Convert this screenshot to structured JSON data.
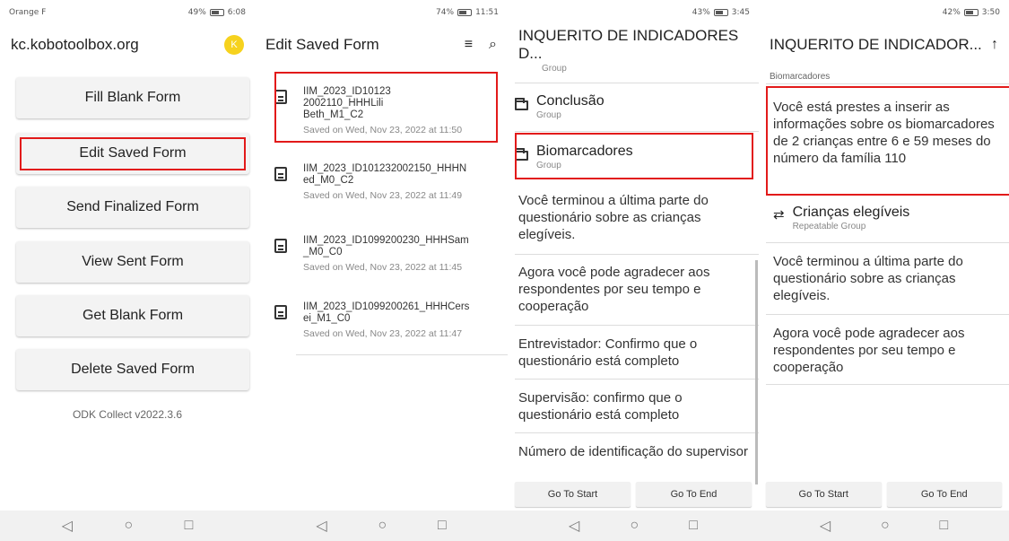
{
  "phone1": {
    "status_left": "Orange F",
    "status_right": "49%",
    "status_time": "6:08",
    "title": "kc.kobotoolbox.org",
    "avatar_letter": "K",
    "buttons": [
      "Fill Blank Form",
      "Edit Saved Form",
      "Send Finalized Form",
      "View Sent Form",
      "Get Blank Form",
      "Delete Saved Form"
    ],
    "version": "ODK Collect v2022.3.6"
  },
  "phone2": {
    "status_right": "74%",
    "status_time": "11:51",
    "title": "Edit Saved Form",
    "forms": [
      {
        "name": "IIM_2023_ID10123\n2002110_HHHLili\nBeth_M1_C2",
        "saved": "Saved on Wed, Nov 23, 2022 at 11:50"
      },
      {
        "name": "IIM_2023_ID101232002150_HHHN\ned_M0_C2",
        "saved": "Saved on Wed, Nov 23, 2022 at 11:49"
      },
      {
        "name": "IIM_2023_ID1099200230_HHHSam\n_M0_C0",
        "saved": "Saved on Wed, Nov 23, 2022 at 11:45"
      },
      {
        "name": "IIM_2023_ID1099200261_HHHCers\nei_M1_C0",
        "saved": "Saved on Wed, Nov 23, 2022 at 11:47"
      }
    ]
  },
  "phone3": {
    "status_right": "43%",
    "status_time": "3:45",
    "title": "INQUERITO DE INDICADORES D...",
    "top_group_sub": "Group",
    "groups": [
      {
        "title": "Conclusão",
        "sub": "Group"
      },
      {
        "title": "Biomarcadores",
        "sub": "Group"
      }
    ],
    "questions": [
      "Você terminou a última parte do questionário sobre as crianças elegíveis.",
      "Agora você pode agradecer aos respondentes por seu tempo e cooperação",
      "Entrevistador: Confirmo que o questionário está completo",
      "Supervisão: confirmo que o questionário está completo",
      "Número de identificação do supervisor"
    ],
    "go_start": "Go To Start",
    "go_end": "Go To End"
  },
  "phone4": {
    "status_right": "42%",
    "status_time": "3:50",
    "title": "INQUERITO DE INDICADOR...",
    "breadcrumb": "Biomarcadores",
    "intro": "Você está prestes a inserir as informações sobre os biomarcadores de 2 crianças entre 6 e 59 meses do número da família 110",
    "repeat_title": "Crianças elegíveis",
    "repeat_sub": "Repeatable Group",
    "questions": [
      "Você terminou a última parte do questionário sobre as crianças elegíveis.",
      "Agora você pode agradecer aos respondentes por seu tempo e cooperação"
    ],
    "go_start": "Go To Start",
    "go_end": "Go To End"
  },
  "colors": {
    "highlight": "#e21a1a",
    "avatar": "#f6d21e"
  }
}
